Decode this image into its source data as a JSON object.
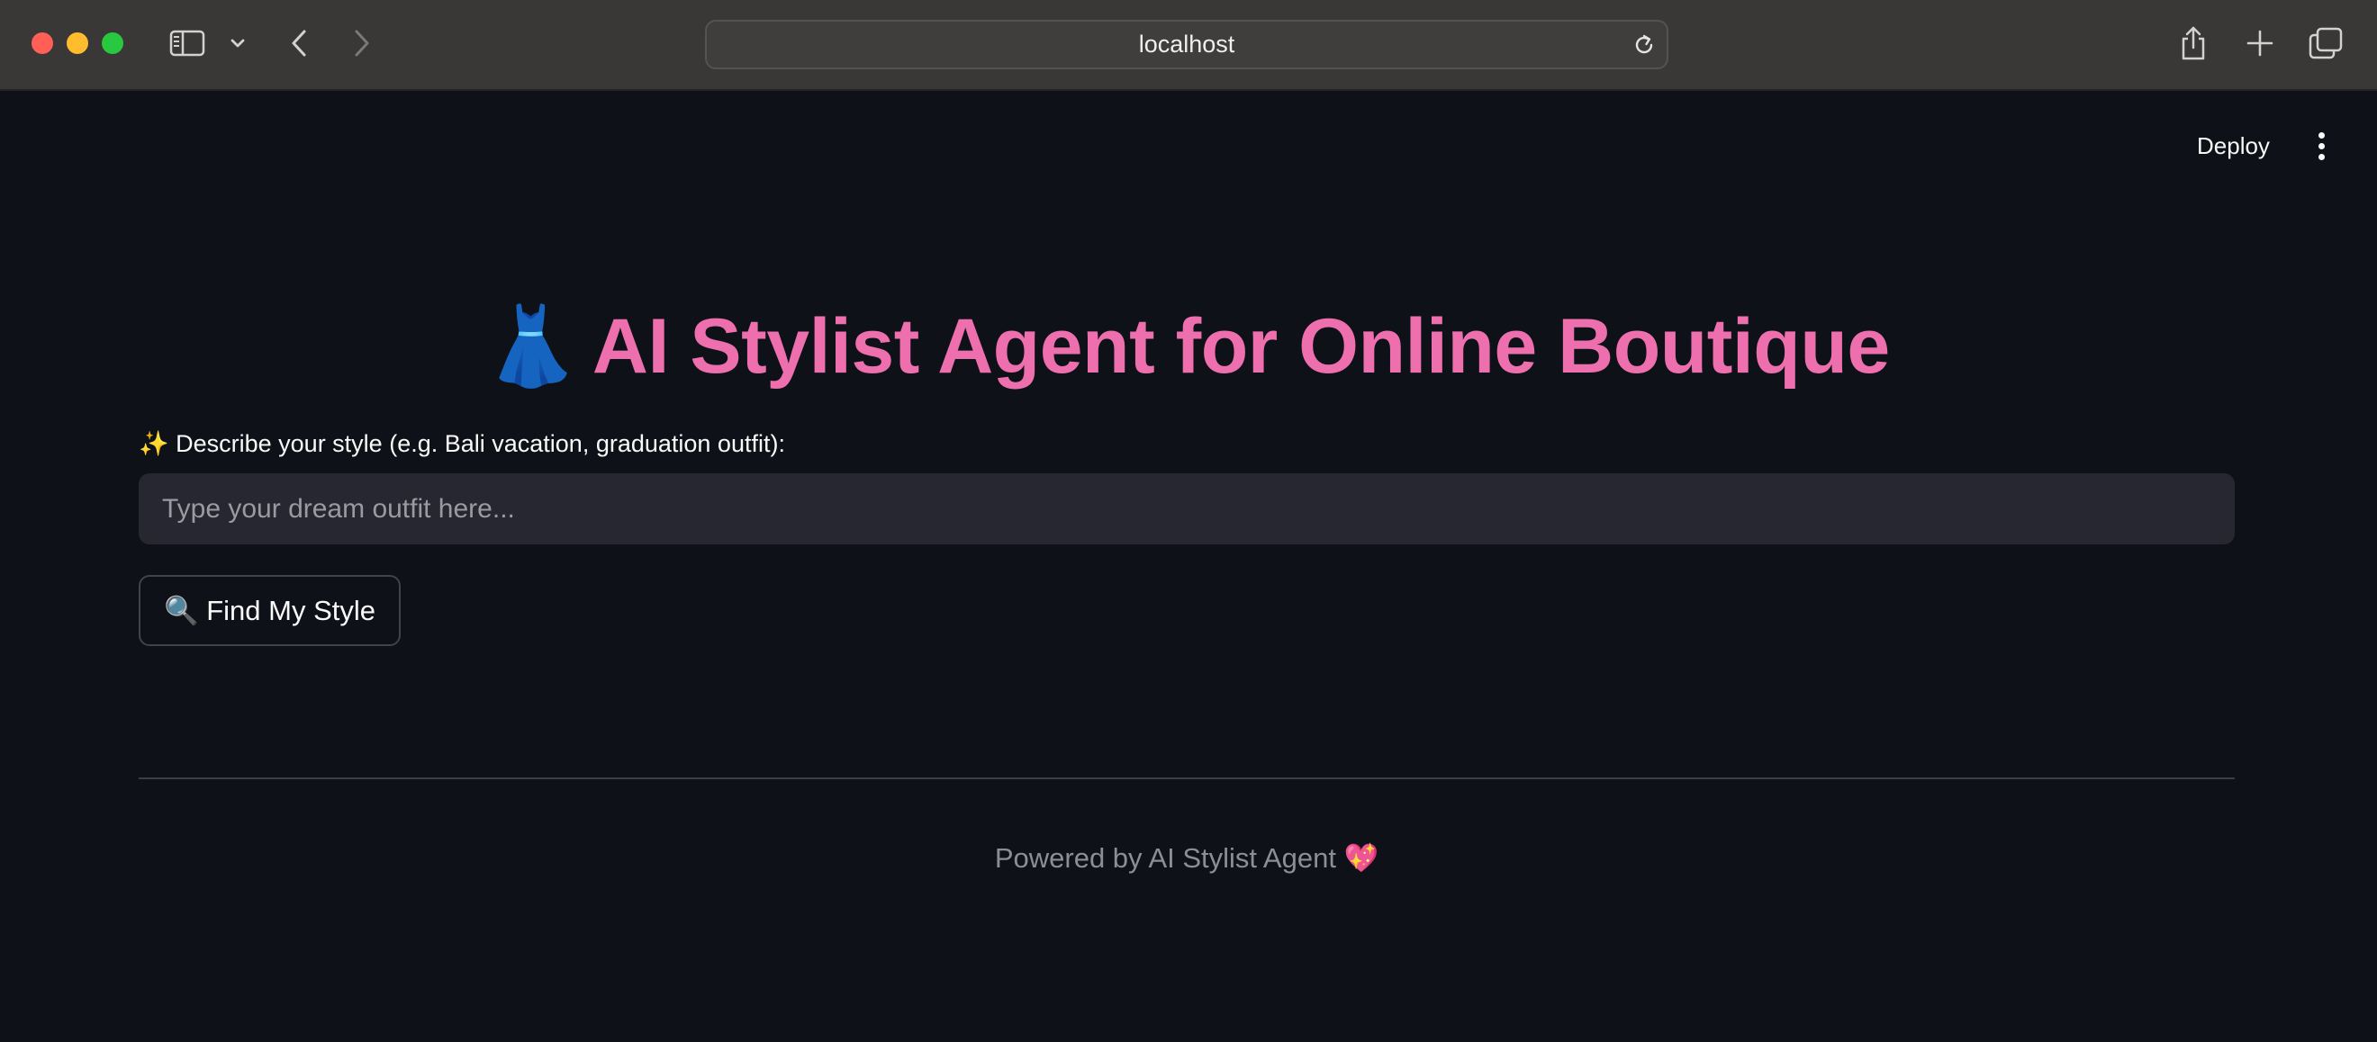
{
  "browser": {
    "address": "localhost",
    "icons": {
      "sidebar": "sidebar-icon",
      "caret": "chevron-down-icon",
      "back": "chevron-left-icon",
      "forward": "chevron-right-icon",
      "reload": "reload-icon",
      "share": "share-icon",
      "new_tab": "plus-icon",
      "tabs": "tab-overview-icon"
    },
    "colors": {
      "close": "#ff5f57",
      "minimize": "#febc2e",
      "maximize": "#28c840"
    }
  },
  "app": {
    "deploy_label": "Deploy",
    "menu_icon": "kebab-menu-icon",
    "title_emoji": "👗",
    "title": "AI Stylist Agent for Online Boutique",
    "input_label": "✨ Describe your style (e.g. Bali vacation, graduation outfit):",
    "input_value": "",
    "input_placeholder": "Type your dream outfit here...",
    "button_label": "🔍 Find My Style",
    "footer": "Powered by AI Stylist Agent 💖",
    "colors": {
      "title": "#ee6fad",
      "background": "#0e1117",
      "input_bg": "#262730"
    }
  }
}
